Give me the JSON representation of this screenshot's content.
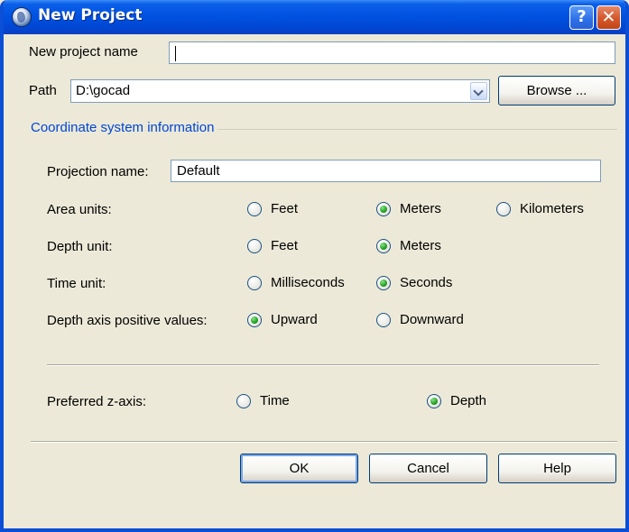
{
  "window": {
    "title": "New Project"
  },
  "titlebar": {
    "help": "?",
    "close": "✕"
  },
  "project_name": {
    "label": "New project name",
    "value": ""
  },
  "path": {
    "label": "Path",
    "value": "D:\\gocad",
    "browse_label": "Browse ..."
  },
  "coordinate_group": {
    "title": "Coordinate system information",
    "projection_label": "Projection name:",
    "projection_value": "Default",
    "area_units": {
      "label": "Area units:",
      "options": [
        "Feet",
        "Meters",
        "Kilometers"
      ],
      "selected": "Meters"
    },
    "depth_unit": {
      "label": "Depth unit:",
      "options": [
        "Feet",
        "Meters"
      ],
      "selected": "Meters"
    },
    "time_unit": {
      "label": "Time unit:",
      "options": [
        "Milliseconds",
        "Seconds"
      ],
      "selected": "Seconds"
    },
    "depth_axis": {
      "label": "Depth axis positive values:",
      "options": [
        "Upward",
        "Downward"
      ],
      "selected": "Upward"
    },
    "z_axis": {
      "label": "Preferred z-axis:",
      "options": [
        "Time",
        "Depth"
      ],
      "selected": "Depth"
    }
  },
  "buttons": {
    "ok": "OK",
    "cancel": "Cancel",
    "help": "Help"
  },
  "colors": {
    "title_bar": "#0051e0",
    "group_title": "#0046d5",
    "radio_selected": "#21a121"
  }
}
